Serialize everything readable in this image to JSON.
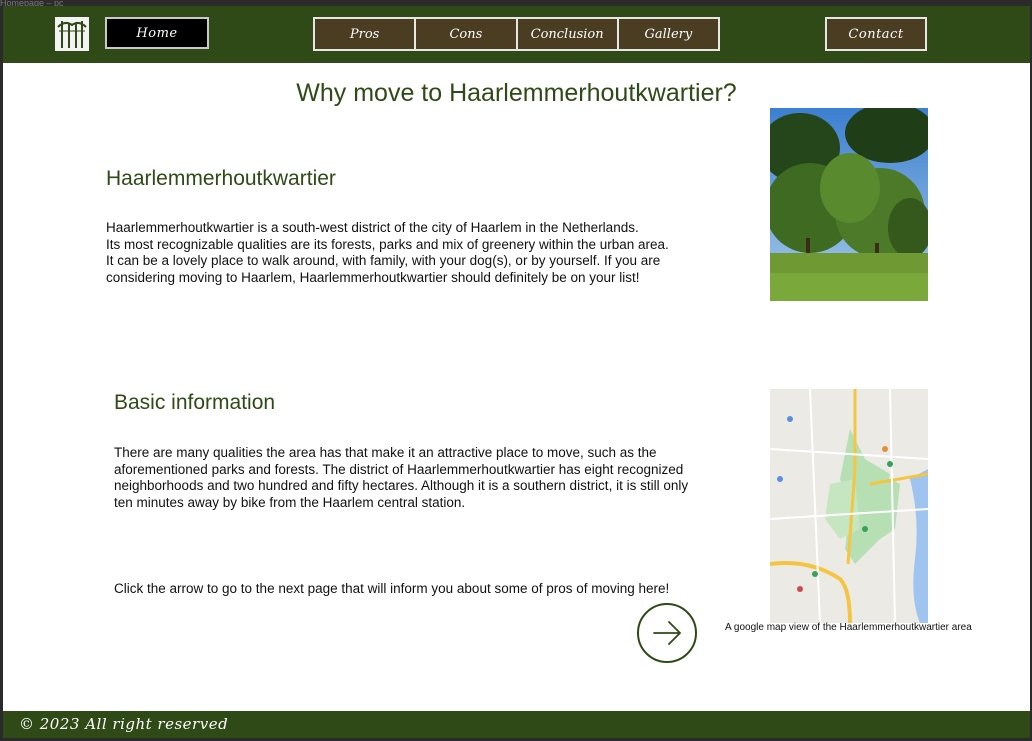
{
  "window": {
    "title": "Homepage – pc"
  },
  "nav": {
    "home": "Home",
    "items": [
      {
        "label": "Pros"
      },
      {
        "label": "Cons"
      },
      {
        "label": "Conclusion"
      },
      {
        "label": "Gallery"
      }
    ],
    "contact": "Contact"
  },
  "main": {
    "title": "Why move to Haarlemmerhoutkwartier?",
    "section1": {
      "heading": "Haarlemmerhoutkwartier",
      "lines": [
        "Haarlemmerhoutkwartier is a south-west district of the city of Haarlem in the Netherlands.",
        "Its most recognizable qualities are its forests, parks and mix of greenery within the urban area.",
        "It can be a lovely place to walk around, with family, with your dog(s), or by yourself. If you are",
        "considering moving to Haarlem, Haarlemmerhoutkwartier should definitely be on your list!"
      ]
    },
    "section2": {
      "heading": "Basic information",
      "lines": [
        "There are many qualities the area has that make it an attractive place to move, such as the",
        "aforementioned parks and forests. The district of Haarlemmerhoutkwartier has eight recognized",
        "neighborhoods and two hundred and fifty hectares. Although it is a southern district, it is still only",
        "ten minutes away by bike from the Haarlem central station."
      ],
      "cta": "Click the arrow to go to the next page that will inform you about some of pros of moving here!"
    },
    "map_caption": "A google map view of the Haarlemmerhoutkwartier area"
  },
  "footer": {
    "text": "© 2023 All right reserved"
  },
  "colors": {
    "accent": "#2f4a16",
    "nav_button": "#4a3d22"
  }
}
